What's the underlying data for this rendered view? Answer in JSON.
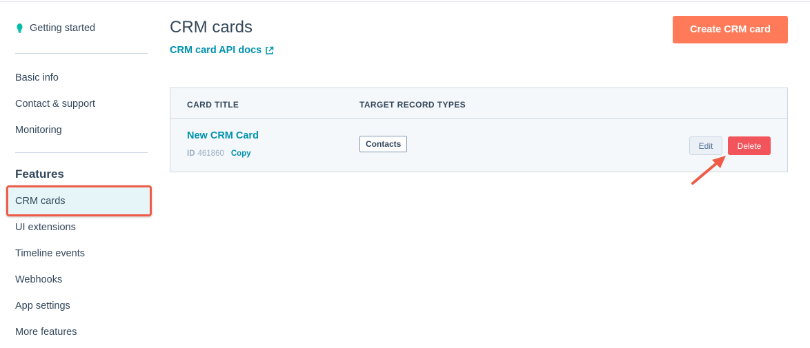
{
  "sidebar": {
    "getting_started": "Getting started",
    "items_top": [
      "Basic info",
      "Contact & support",
      "Monitoring"
    ],
    "features_heading": "Features",
    "active_item": "CRM cards",
    "items_bottom": [
      "UI extensions",
      "Timeline events",
      "Webhooks",
      "App settings",
      "More features"
    ]
  },
  "main": {
    "title": "CRM cards",
    "api_link": "CRM card API docs",
    "create_button": "Create CRM card",
    "table": {
      "headers": [
        "CARD TITLE",
        "TARGET RECORD TYPES"
      ],
      "rows": [
        {
          "title": "New CRM Card",
          "id_label": "ID",
          "id_value": "461860",
          "copy_label": "Copy",
          "record_type": "Contacts",
          "edit_label": "Edit",
          "delete_label": "Delete"
        }
      ]
    }
  },
  "icons": {
    "getting_started": "lightbulb-icon",
    "api_link": "external-link-icon",
    "annotation": "arrow-icon"
  },
  "colors": {
    "accent": "#0091ae",
    "create_button": "#ff7a59",
    "delete_button": "#f2545b",
    "highlight_border": "#ef5b47"
  }
}
